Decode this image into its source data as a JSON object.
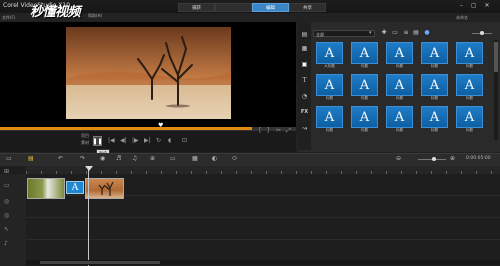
{
  "window": {
    "title": "Corel VideoStudio X10",
    "watermark": "秒懂视频",
    "menu": {
      "file": "文件(F)",
      "help": "帮助(H)"
    },
    "controls": "– ▢ ✕",
    "project_properties": "未命名"
  },
  "steps": {
    "capture": "捕获",
    "edit": "编辑",
    "share": "共享",
    "active": "edit"
  },
  "preview": {
    "project_label": "项目",
    "clip_label": "素材",
    "tooltip": "暂停",
    "progress": 0.85,
    "transport_icons": [
      "start-icon",
      "prev-frame-icon",
      "next-frame-icon",
      "end-icon",
      "repeat-icon",
      "volume-icon"
    ]
  },
  "library": {
    "dropdown_value": "全部",
    "titles": [
      {
        "label": "大标题"
      },
      {
        "label": "标题"
      },
      {
        "label": "标题"
      },
      {
        "label": "标题"
      },
      {
        "label": "标题"
      },
      {
        "label": "标题"
      },
      {
        "label": "标题"
      },
      {
        "label": "标题"
      },
      {
        "label": "标题"
      },
      {
        "label": "标题"
      },
      {
        "label": "标题"
      },
      {
        "label": "标题"
      },
      {
        "label": "标题"
      },
      {
        "label": "标题"
      },
      {
        "label": "标题"
      }
    ],
    "sidebar_icons": [
      "media-icon",
      "instant-project-icon",
      "transition-icon",
      "title-icon",
      "graphic-icon",
      "fx-icon",
      "path-icon"
    ]
  },
  "toolbar": {
    "timecode": "0:00:05:00",
    "icons": [
      "storyboard-view-icon",
      "timeline-view-icon",
      "undo-icon",
      "redo-icon",
      "record-icon",
      "sound-mixer-icon",
      "auto-music-icon",
      "motion-tracking-icon",
      "subtitle-icon",
      "multi-camera-icon",
      "stop-motion-icon",
      "split-icon",
      "zoom-out-icon",
      "zoom-in-icon",
      "fit-icon"
    ]
  },
  "timeline": {
    "tracks": [
      "video-track",
      "overlay-track",
      "title-track",
      "voice-track",
      "music-track"
    ],
    "clips": [
      {
        "name": "dandelion-clip",
        "type": "video"
      },
      {
        "name": "title-clip",
        "glyph": "A",
        "type": "title"
      },
      {
        "name": "desert-tree-clip",
        "type": "video"
      }
    ]
  },
  "colors": {
    "accent": "#3b85c4",
    "progress": "#e08a12",
    "tile_blue": "#1f7cc7"
  }
}
